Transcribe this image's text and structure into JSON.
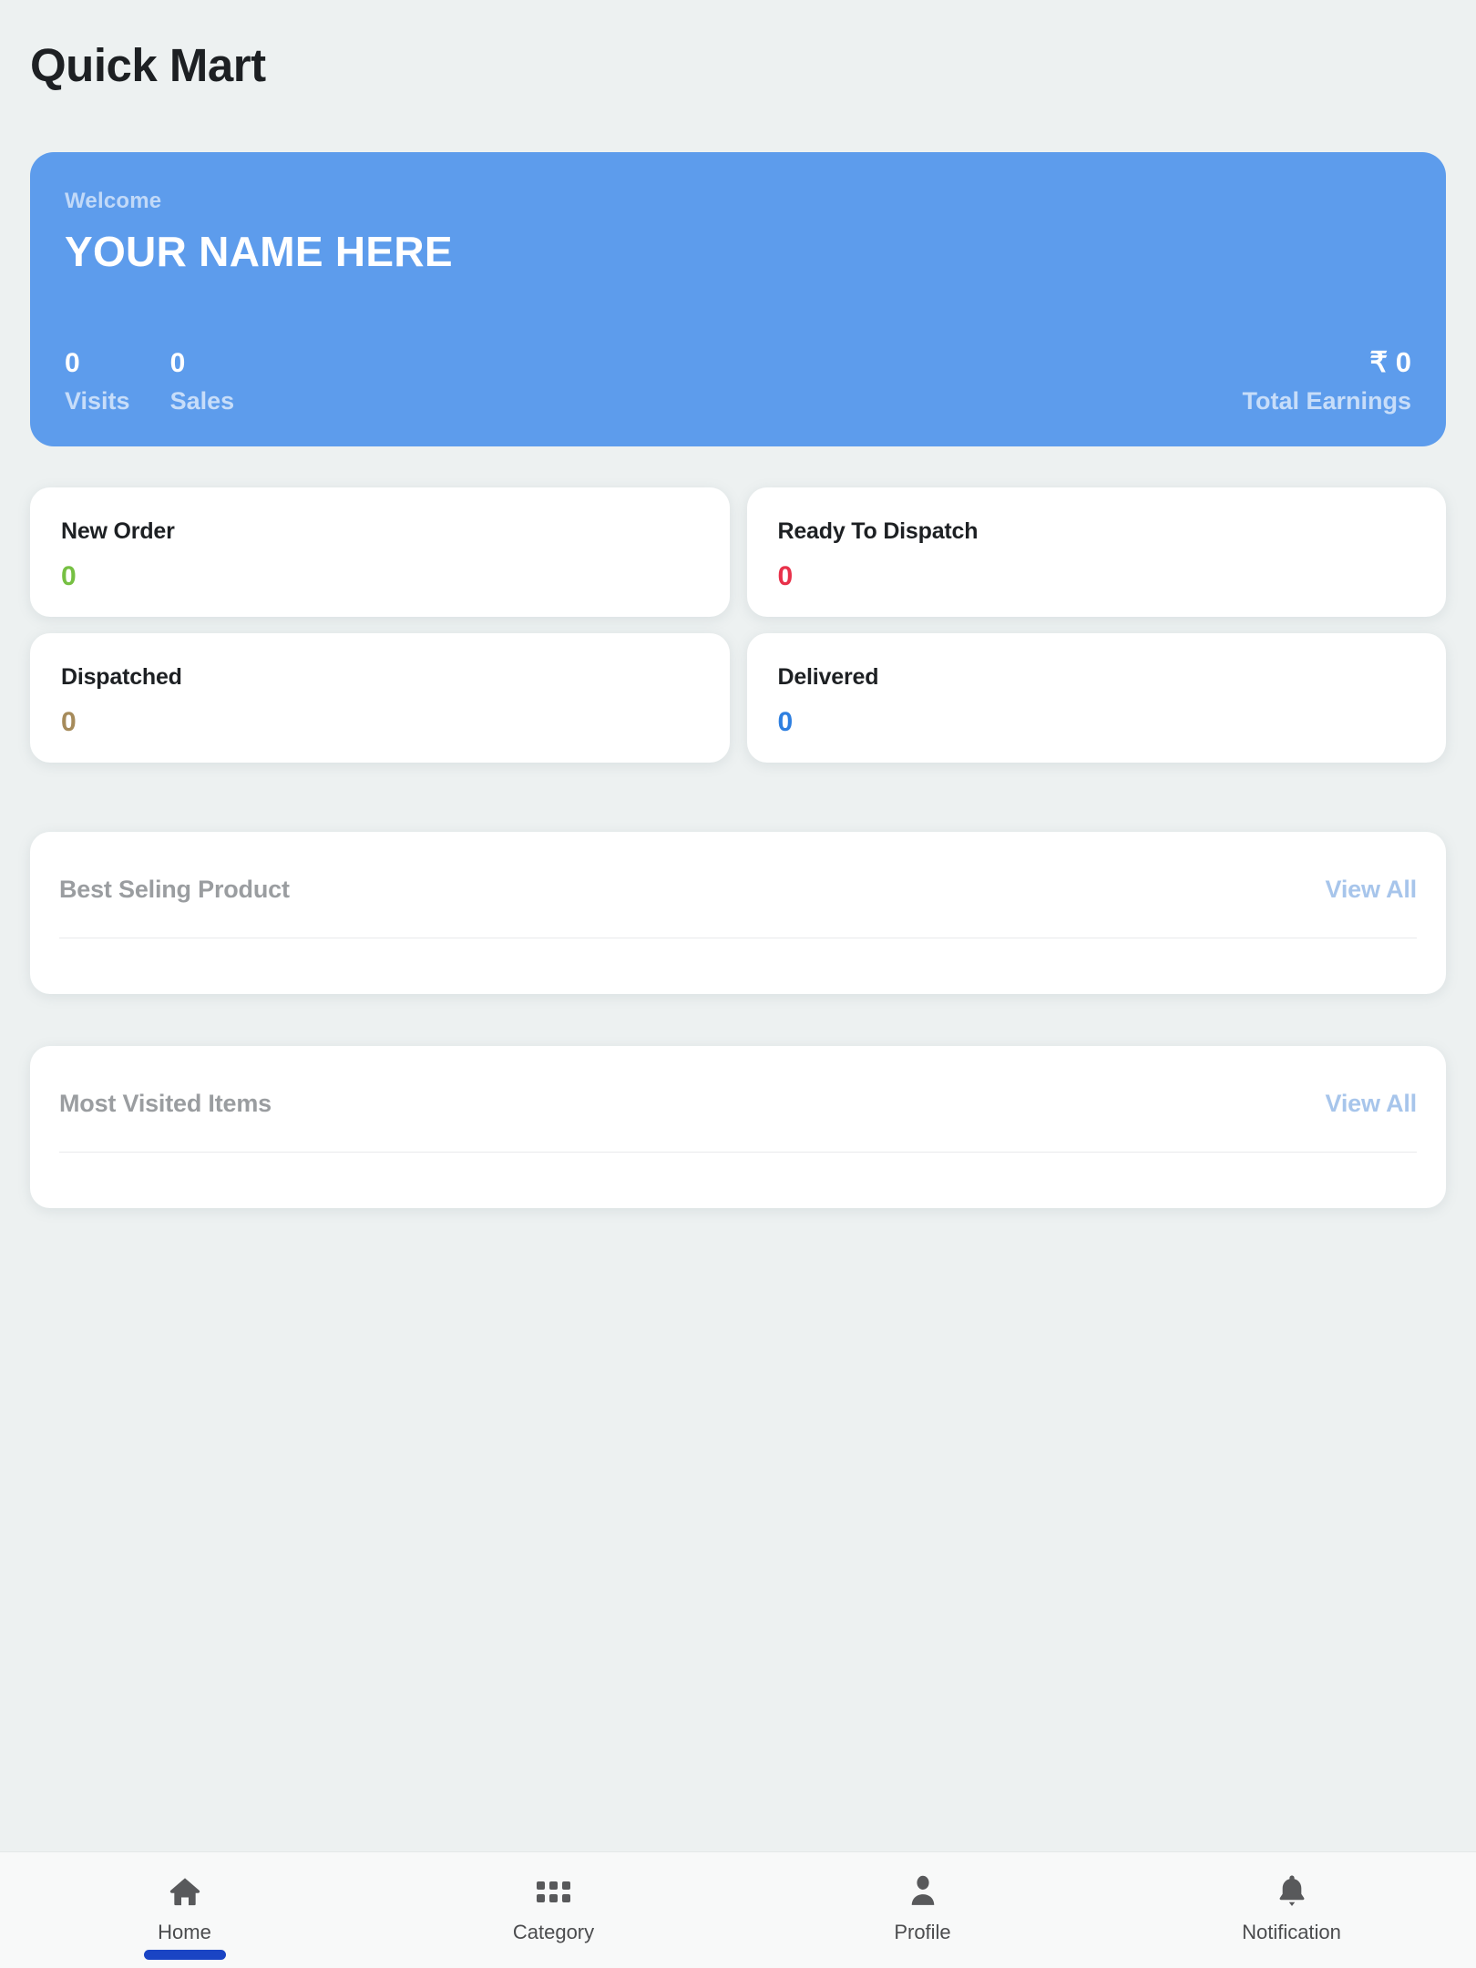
{
  "header": {
    "title": "Quick Mart"
  },
  "hero": {
    "welcome_label": "Welcome",
    "user_name": "YOUR NAME HERE",
    "accent_color": "#5D9CEC",
    "stats": [
      {
        "value": "0",
        "label": "Visits"
      },
      {
        "value": "0",
        "label": "Sales"
      }
    ],
    "earnings": {
      "value": "₹ 0",
      "label": "Total Earnings"
    }
  },
  "metrics": [
    {
      "title": "New Order",
      "value": "0",
      "color": "#76c043"
    },
    {
      "title": "Ready To Dispatch",
      "value": "0",
      "color": "#e8314a"
    },
    {
      "title": "Dispatched",
      "value": "0",
      "color": "#a68b5b"
    },
    {
      "title": "Delivered",
      "value": "0",
      "color": "#2e7fe0"
    }
  ],
  "panels": [
    {
      "title": "Best Seling Product",
      "view_all": "View All"
    },
    {
      "title": "Most Visited Items",
      "view_all": "View All"
    }
  ],
  "bottom_nav": {
    "active_index": 0,
    "active_color": "#1A44C4",
    "items": [
      {
        "label": "Home",
        "icon": "home-icon"
      },
      {
        "label": "Category",
        "icon": "grid-dots-icon"
      },
      {
        "label": "Profile",
        "icon": "person-icon"
      },
      {
        "label": "Notification",
        "icon": "bell-icon"
      }
    ]
  }
}
